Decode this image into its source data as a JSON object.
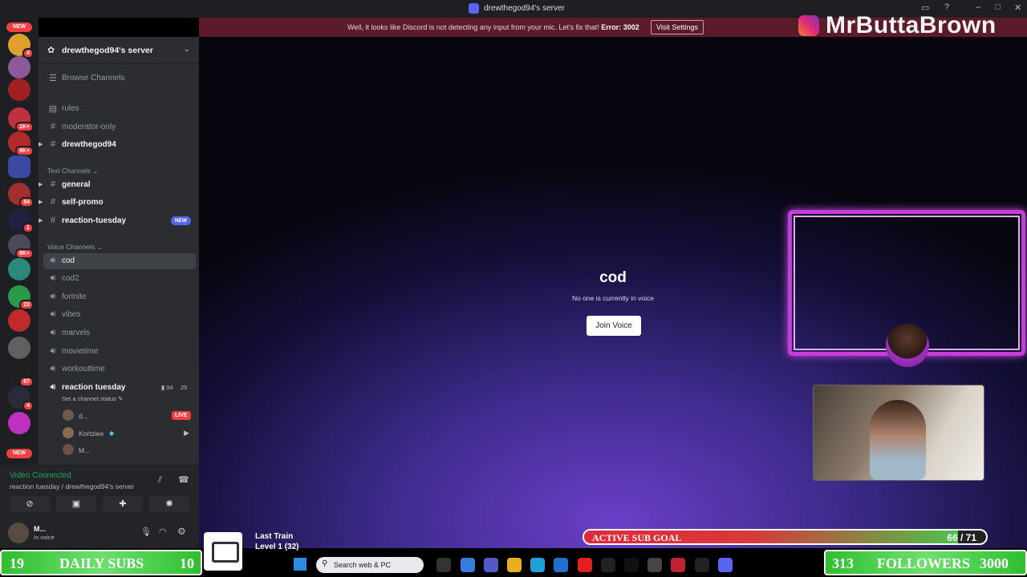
{
  "window": {
    "title": "drewthegod94's server"
  },
  "notice": {
    "message": "Well, it looks like Discord is not detecting any input from your mic. Let's fix that!",
    "error": "Error: 3002",
    "button": "Visit Settings"
  },
  "rail": {
    "new_top": "NEW",
    "new_bottom": "NEW",
    "badges": [
      "4",
      "1K+",
      "9K+",
      "84",
      "1",
      "9K+",
      "23",
      "67",
      "4"
    ]
  },
  "server": {
    "name": "drewthegod94's server",
    "browse": "Browse Channels"
  },
  "channels": {
    "top": [
      {
        "label": "rules"
      },
      {
        "label": "moderator-only"
      },
      {
        "label": "drewthegod94"
      }
    ],
    "text_category": "Text Channels",
    "text": [
      {
        "label": "general"
      },
      {
        "label": "self-promo"
      },
      {
        "label": "reaction-tuesday",
        "badge": "NEW"
      }
    ],
    "voice_category": "Voice Channels",
    "voice": [
      {
        "label": "cod"
      },
      {
        "label": "cod2"
      },
      {
        "label": "fortnite"
      },
      {
        "label": "vibes"
      },
      {
        "label": "marvels"
      },
      {
        "label": "movietime"
      },
      {
        "label": "workouttime"
      },
      {
        "label": "reaction tuesday"
      }
    ],
    "reaction_status": "Set a channel status",
    "reaction_counts": {
      "a": "04",
      "b": "25"
    },
    "voice_users": [
      {
        "name": "d...",
        "badge": "LIVE"
      },
      {
        "name": "Kortziee"
      },
      {
        "name": "M..."
      }
    ]
  },
  "voice_panel": {
    "status": "Video Connected",
    "location": "reaction tuesday / drewthegod94's server"
  },
  "user_panel": {
    "name": "M...",
    "status": "In voice"
  },
  "stage": {
    "channel": "cod",
    "subtitle": "No one is currently in voice",
    "join": "Join Voice"
  },
  "overlay": {
    "brand": "MrButtaBrown",
    "sub_goal_label": "ACTIVE SUB GOAL",
    "sub_goal_value": "66 / 71",
    "sub_goal_current": 66,
    "sub_goal_target": 71,
    "daily_left": "19",
    "daily_label": "DAILY SUBS",
    "daily_right": "10",
    "followers_left": "313",
    "followers_label": "FOLLOWERS",
    "followers_right": "3000",
    "song": "Last Train",
    "level": "Level 1  (32)"
  },
  "taskbar": {
    "search": "Search web & PC"
  },
  "colors": {
    "accent": "#5865f2",
    "danger": "#f23f43",
    "online": "#23a55a",
    "goal_bar": "#4cc24c",
    "frame": "#c33fd8"
  }
}
